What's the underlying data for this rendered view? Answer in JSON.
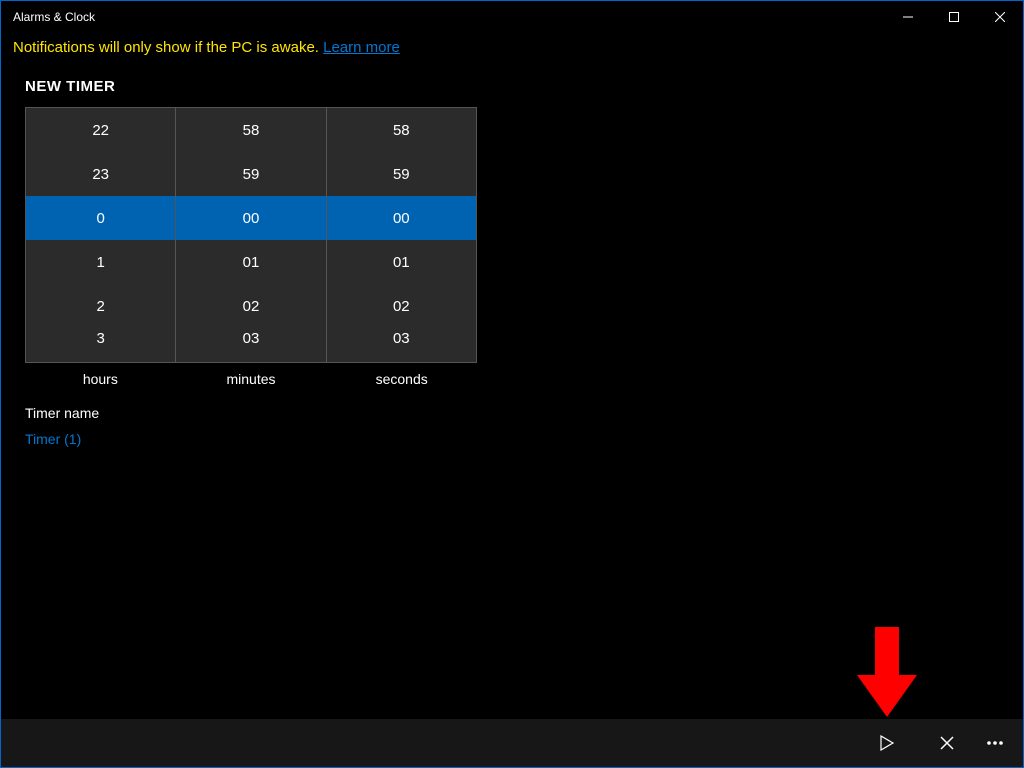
{
  "window": {
    "title": "Alarms & Clock"
  },
  "notification": {
    "text": "Notifications will only show if the PC is awake. ",
    "link": "Learn more"
  },
  "section": {
    "title": "NEW TIMER"
  },
  "picker": {
    "hours": {
      "label": "hours",
      "items": [
        "22",
        "23",
        "0",
        "1",
        "2",
        "3"
      ]
    },
    "minutes": {
      "label": "minutes",
      "items": [
        "58",
        "59",
        "00",
        "01",
        "02",
        "03"
      ]
    },
    "seconds": {
      "label": "seconds",
      "items": [
        "58",
        "59",
        "00",
        "01",
        "02",
        "03"
      ]
    },
    "selected_index": 2
  },
  "timer_name": {
    "label": "Timer name",
    "value": "Timer (1)"
  },
  "bottom": {
    "play": "Play",
    "cancel": "Cancel",
    "more": "More"
  },
  "annotation": {
    "arrow_color": "#ff0000"
  }
}
